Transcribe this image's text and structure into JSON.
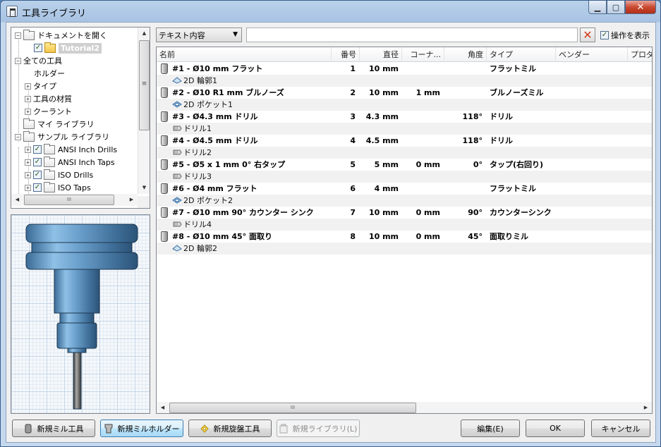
{
  "window": {
    "title": "工具ライブラリ"
  },
  "tree": {
    "items": [
      {
        "label": "ドキュメントを開く"
      },
      {
        "label": "Tutorial2"
      },
      {
        "label": "全ての工具"
      },
      {
        "label": "ホルダー"
      },
      {
        "label": "タイプ"
      },
      {
        "label": "工具の材質"
      },
      {
        "label": "クーラント"
      },
      {
        "label": "マイ ライブラリ"
      },
      {
        "label": "サンプル ライブラリ"
      },
      {
        "label": "ANSI Inch Drills"
      },
      {
        "label": "ANSI Inch Taps"
      },
      {
        "label": "ISO Drills"
      },
      {
        "label": "ISO Taps"
      }
    ],
    "scroll_thumb_glyph": "≡",
    "hscroll_thumb_glyph": "III"
  },
  "toolbar": {
    "filter_combo": "テキスト内容",
    "search_value": "",
    "show_ops_label": "操作を表示"
  },
  "list": {
    "columns": [
      "名前",
      "番号",
      "直径",
      "コーナ...",
      "角度",
      "タイプ",
      "ベンダー",
      "プロダ"
    ],
    "rows": [
      {
        "name": "#1 - Ø10 mm フラット",
        "number": "1",
        "diameter": "10 mm",
        "corner": "",
        "angle": "",
        "type": "フラットミル",
        "op_icon": "contour-icon",
        "op": "2D 輪郭1"
      },
      {
        "name": "#2 - Ø10 R1 mm ブルノーズ",
        "number": "2",
        "diameter": "10 mm",
        "corner": "1 mm",
        "angle": "",
        "type": "ブルノーズミル",
        "op_icon": "pocket-icon",
        "op": "2D ポケット1"
      },
      {
        "name": "#3 - Ø4.3 mm ドリル",
        "number": "3",
        "diameter": "4.3 mm",
        "corner": "",
        "angle": "118°",
        "type": "ドリル",
        "op_icon": "drill-op-icon",
        "op": "ドリル1"
      },
      {
        "name": "#4 - Ø4.5 mm ドリル",
        "number": "4",
        "diameter": "4.5 mm",
        "corner": "",
        "angle": "118°",
        "type": "ドリル",
        "op_icon": "drill-op-icon",
        "op": "ドリル2"
      },
      {
        "name": "#5 - Ø5 x 1 mm 0° 右タップ",
        "number": "5",
        "diameter": "5 mm",
        "corner": "0 mm",
        "angle": "0°",
        "type": "タップ(右回り)",
        "op_icon": "drill-op-icon",
        "op": "ドリル3"
      },
      {
        "name": "#6 - Ø4 mm フラット",
        "number": "6",
        "diameter": "4 mm",
        "corner": "",
        "angle": "",
        "type": "フラットミル",
        "op_icon": "pocket-icon",
        "op": "2D ポケット2"
      },
      {
        "name": "#7 - Ø10 mm 90° カウンター シンク",
        "number": "7",
        "diameter": "10 mm",
        "corner": "0 mm",
        "angle": "90°",
        "type": "カウンターシンク",
        "op_icon": "drill-op-icon",
        "op": "ドリル4"
      },
      {
        "name": "#8 - Ø10 mm 45° 面取り",
        "number": "8",
        "diameter": "10 mm",
        "corner": "0 mm",
        "angle": "45°",
        "type": "面取りミル",
        "op_icon": "contour-icon",
        "op": "2D 輪郭2"
      }
    ]
  },
  "buttons": {
    "new_mill_tool": "新規ミル工具",
    "new_mill_holder": "新規ミルホルダー",
    "new_lathe_tool": "新規旋盤工具",
    "new_library": "新規ライブラリ(L)",
    "edit": "編集(E)",
    "ok": "OK",
    "cancel": "キャンセル"
  },
  "colors": {
    "accent": "#3c7fb1",
    "clear_x": "#d33a1a",
    "titlebar": "#b9d1ea"
  }
}
